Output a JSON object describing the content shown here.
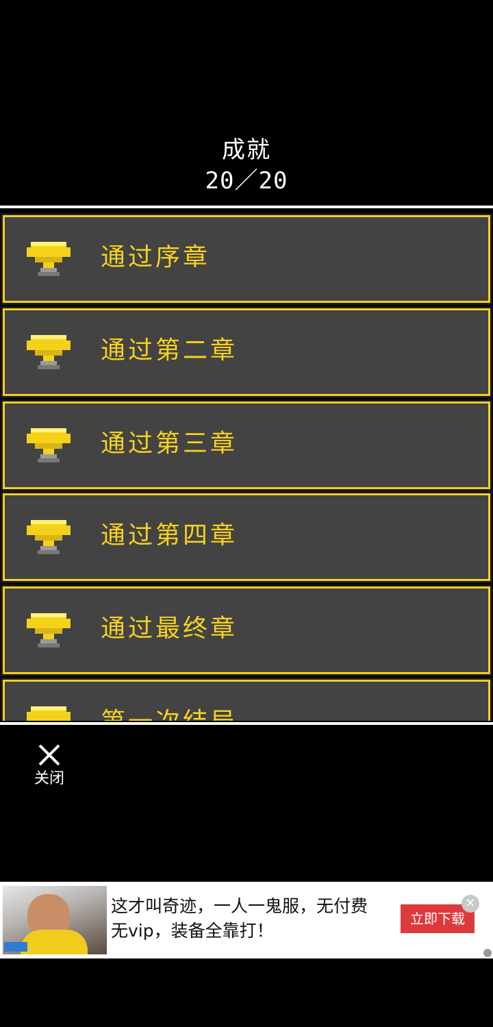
{
  "header": {
    "title": "成就",
    "count": "20／20"
  },
  "achievements": [
    {
      "label": "通过序章",
      "icon": "trophy-icon"
    },
    {
      "label": "通过第二章",
      "icon": "trophy-icon"
    },
    {
      "label": "通过第三章",
      "icon": "trophy-icon"
    },
    {
      "label": "通过第四章",
      "icon": "trophy-icon"
    },
    {
      "label": "通过最终章",
      "icon": "trophy-icon"
    },
    {
      "label": "第一次结局",
      "icon": "trophy-icon"
    }
  ],
  "close": {
    "label": "关闭",
    "icon": "close-icon"
  },
  "ad": {
    "text": "这才叫奇迹，一人一鬼服，无付费无vip，装备全靠打！",
    "button": "立即下载",
    "close_icon": "ad-close-icon"
  },
  "colors": {
    "background": "#000000",
    "card": "#434343",
    "border": "#f4cf1f",
    "text_gold": "#f7d21c",
    "ad_button": "#de3a3e"
  }
}
